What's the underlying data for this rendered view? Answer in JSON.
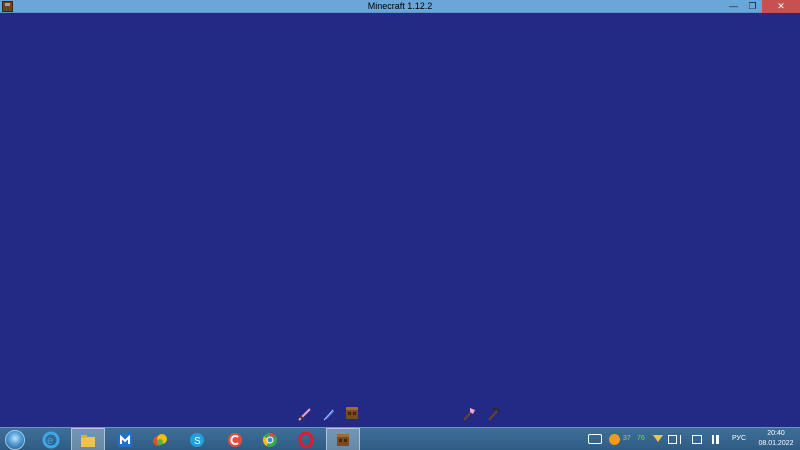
{
  "window": {
    "title": "Minecraft 1.12.2",
    "controls": {
      "minimize": "—",
      "maximize": "❐",
      "close": "✕"
    }
  },
  "game": {
    "background_color": "#222a86",
    "hotbar_items": [
      "pink-sword-icon",
      "blue-feather-icon",
      "crafting-table-icon",
      "pink-axe-icon",
      "dark-pickaxe-icon"
    ]
  },
  "taskbar": {
    "apps": [
      "internet-explorer-icon",
      "file-explorer-icon",
      "maxthon-icon",
      "fruit-app-icon",
      "skype-icon",
      "ccleaner-icon",
      "chrome-icon",
      "opera-icon",
      "minecraft-icon"
    ],
    "tray": {
      "num1": "37",
      "num2": "76",
      "language": "РУС",
      "time": "20:40",
      "date": "08.01.2022"
    }
  }
}
